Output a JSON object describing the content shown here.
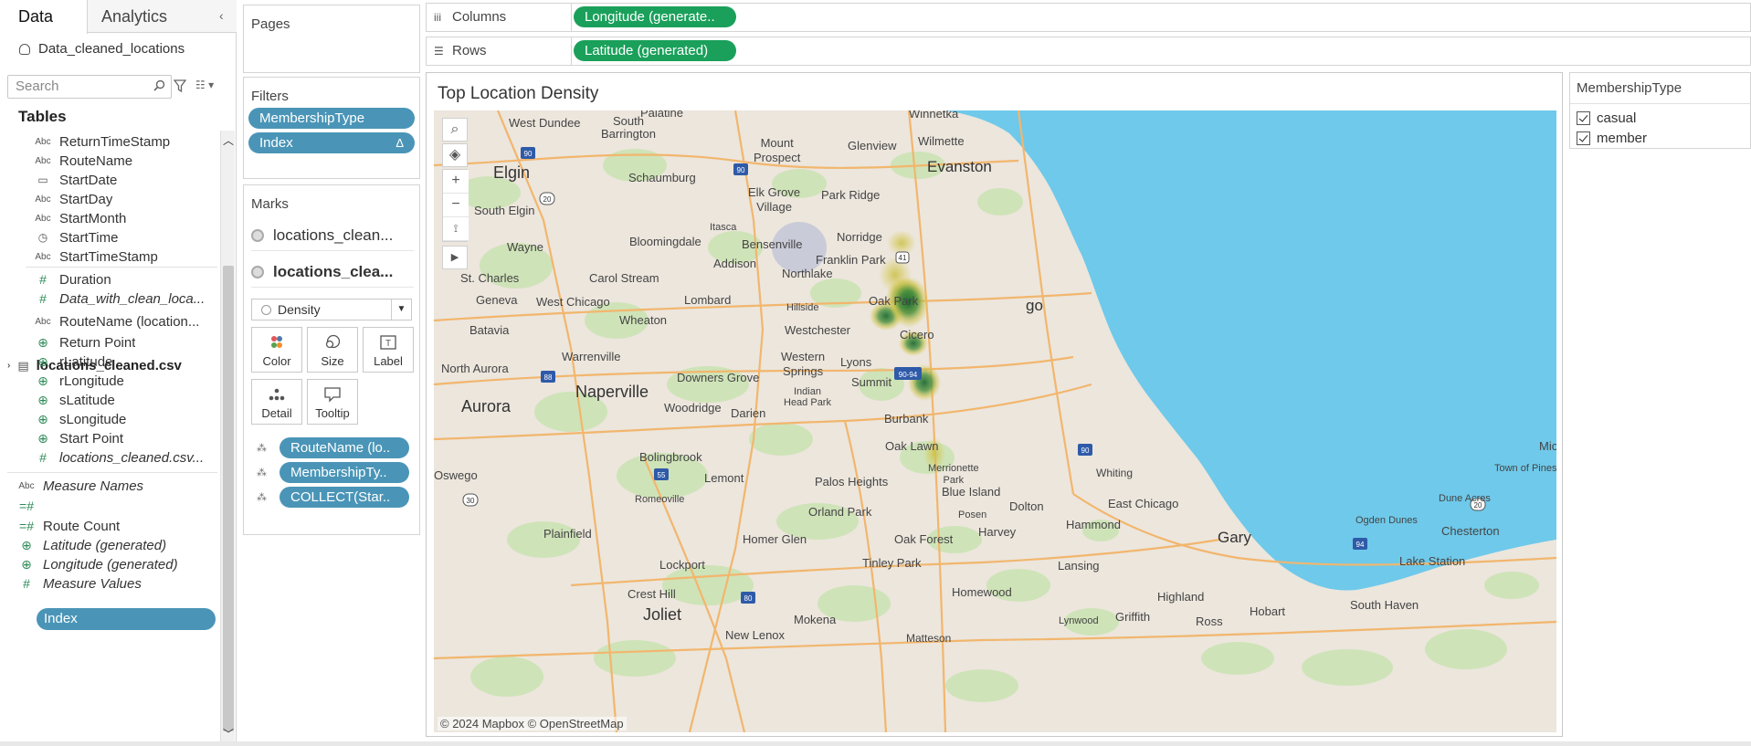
{
  "pane_tabs": {
    "data": "Data",
    "analytics": "Analytics"
  },
  "datasource": "Data_cleaned_locations",
  "search": {
    "placeholder": "Search"
  },
  "tables_label": "Tables",
  "fields_top": [
    {
      "name": "ReturnTimeStamp",
      "type": "Abc"
    },
    {
      "name": "RouteName",
      "type": "Abc"
    },
    {
      "name": "StartDate",
      "type": "date"
    },
    {
      "name": "StartDay",
      "type": "Abc"
    },
    {
      "name": "StartMonth",
      "type": "Abc"
    },
    {
      "name": "StartTime",
      "type": "datetime"
    },
    {
      "name": "StartTimeStamp",
      "type": "Abc"
    },
    {
      "name": "Duration",
      "type": "#"
    },
    {
      "name": "Data_with_clean_loca...",
      "type": "#"
    }
  ],
  "table2": {
    "name": "locations_cleaned.csv",
    "fields": [
      {
        "name": "RouteName (location...",
        "type": "Abc"
      },
      {
        "name": "Return Point",
        "type": "geo"
      },
      {
        "name": "rLatitude",
        "type": "geo"
      },
      {
        "name": "rLongitude",
        "type": "geo"
      },
      {
        "name": "sLatitude",
        "type": "geo"
      },
      {
        "name": "sLongitude",
        "type": "geo"
      },
      {
        "name": "Start Point",
        "type": "geo"
      },
      {
        "name": "locations_cleaned.csv...",
        "type": "#"
      }
    ]
  },
  "measures": [
    {
      "name": "Measure Names",
      "type": "Abc"
    },
    {
      "name": "Index",
      "type": "=#"
    },
    {
      "name": "Route Count",
      "type": "=#"
    },
    {
      "name": "Latitude (generated)",
      "type": "geo"
    },
    {
      "name": "Longitude (generated)",
      "type": "geo"
    },
    {
      "name": "Measure Values",
      "type": "#"
    }
  ],
  "shelves": {
    "pages": "Pages",
    "filters": "Filters",
    "filter_pills": [
      "MembershipType",
      "Index"
    ],
    "filter_delta": "Δ",
    "marks": "Marks",
    "mark_layers": [
      "locations_clean...",
      "locations_clea..."
    ],
    "mark_type": "Density",
    "mark_cards": [
      "Color",
      "Size",
      "Label",
      "Detail",
      "Tooltip"
    ],
    "mark_pills": [
      "RouteName (lo..",
      "MembershipTy..",
      "COLLECT(Star.."
    ]
  },
  "columns": {
    "label": "Columns",
    "pill": "Longitude (generate.."
  },
  "rows": {
    "label": "Rows",
    "pill": "Latitude (generated)"
  },
  "viz": {
    "title": "Top Location Density",
    "attribution": "© 2024 Mapbox © OpenStreetMap",
    "places": {
      "palatine": "Palatine",
      "winnetka": "Winnetka",
      "west_dundee": "West Dundee",
      "south_barrington": "South\nBarrington",
      "glenview": "Glenview",
      "wilmette": "Wilmette",
      "mount_prospect": "Mount\nProspect",
      "evanston": "Evanston",
      "elgin": "Elgin",
      "schaumburg": "Schaumburg",
      "elk_grove": "Elk Grove\nVillage",
      "park_ridge": "Park Ridge",
      "south_elgin": "South Elgin",
      "itasca": "Itasca",
      "norridge": "Norridge",
      "bloomingdale": "Bloomingdale",
      "bensenville": "Bensenville",
      "wayne": "Wayne",
      "addison": "Addison",
      "franklin_park": "Franklin Park",
      "st_charles": "St. Charles",
      "carol_stream": "Carol Stream",
      "northlake": "Northlake",
      "geneva": "Geneva",
      "west_chicago": "West Chicago",
      "lombard": "Lombard",
      "oak_park": "Oak Park",
      "hillside": "Hillside",
      "batavia": "Batavia",
      "wheaton": "Wheaton",
      "westchester": "Westchester",
      "cicero": "Cicero",
      "chicago_tail": "go",
      "warrenville": "Warrenville",
      "north_aurora": "North Aurora",
      "lyons": "Lyons",
      "western_springs": "Western\nSprings",
      "downers_grove": "Downers Grove",
      "summit": "Summit",
      "naperville": "Naperville",
      "indian_head_park": "Indian\nHead Park",
      "aurora": "Aurora",
      "woodridge": "Woodridge",
      "darien": "Darien",
      "burbank": "Burbank",
      "oak_lawn": "Oak Lawn",
      "bolingbrook": "Bolingbrook",
      "whiting": "Whiting",
      "merrionette_park": "Merrionette\nPark",
      "oswego": "Oswego",
      "lemont": "Lemont",
      "palos_heights": "Palos Heights",
      "blue_island": "Blue Island",
      "dolton": "Dolton",
      "east_chicago": "East Chicago",
      "romeoville": "Romeoville",
      "orland_park": "Orland Park",
      "posen": "Posen",
      "hammond": "Hammond",
      "town_of_pines": "Town of Pines",
      "dune_acres": "Dune Acres",
      "plainfield": "Plainfield",
      "harvey": "Harvey",
      "gary": "Gary",
      "ogden_dunes": "Ogden Dunes",
      "chesterton": "Chesterton",
      "homer_glen": "Homer Glen",
      "oak_forest": "Oak Forest",
      "lockport": "Lockport",
      "tinley_park": "Tinley Park",
      "lansing": "Lansing",
      "lake_station": "Lake Station",
      "crest_hill": "Crest Hill",
      "homewood": "Homewood",
      "highland": "Highland",
      "hobart": "Hobart",
      "south_haven": "South Haven",
      "joliet": "Joliet",
      "griffith": "Griffith",
      "ross": "Ross",
      "mokena": "Mokena",
      "lynwood": "Lynwood",
      "new_lenox": "New Lenox",
      "matteson": "Matteson",
      "mich": "Micl"
    },
    "shields": [
      "90",
      "90",
      "20",
      "41",
      "88",
      "90-94",
      "90",
      "30",
      "55",
      "80",
      "94",
      "20"
    ],
    "colors": {
      "lake": "#6fc9ea",
      "land": "#ece6dd",
      "park": "#cfe3b8",
      "road": "#f2b66d",
      "density_low": "#d9c742",
      "density_high": "#1e6b35"
    }
  },
  "legend": {
    "title": "MembershipType",
    "items": [
      "casual",
      "member"
    ]
  }
}
